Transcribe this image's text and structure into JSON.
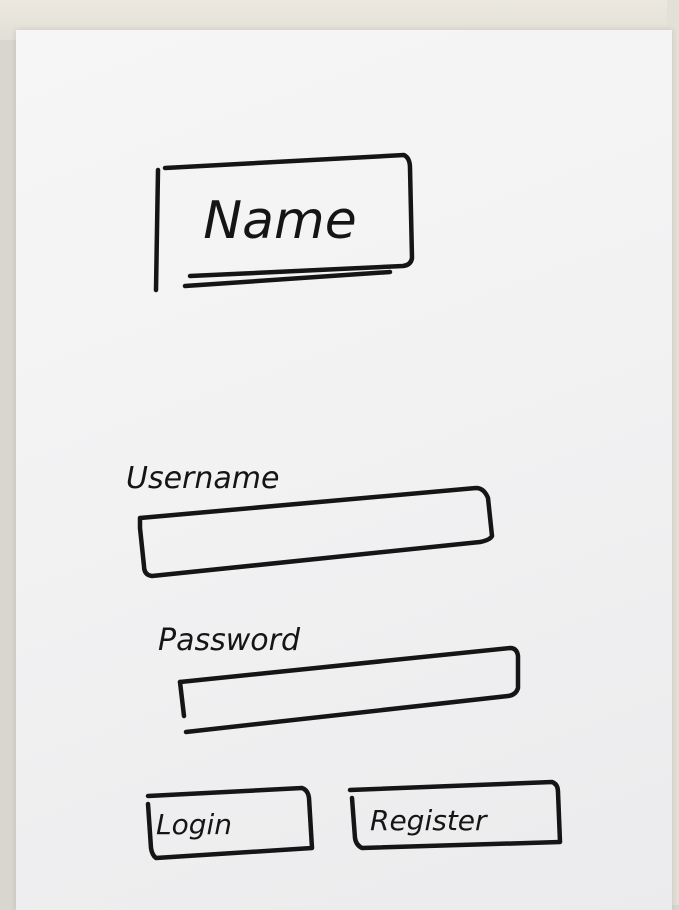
{
  "app_title": "Name",
  "login_form": {
    "username_label": "Username",
    "username_value": "",
    "password_label": "Password",
    "password_value": "",
    "login_button_label": "Login",
    "register_button_label": "Register"
  },
  "colors": {
    "ink": "#151515",
    "paper": "#f4f4f4",
    "backdrop": "#d9d6cf"
  }
}
